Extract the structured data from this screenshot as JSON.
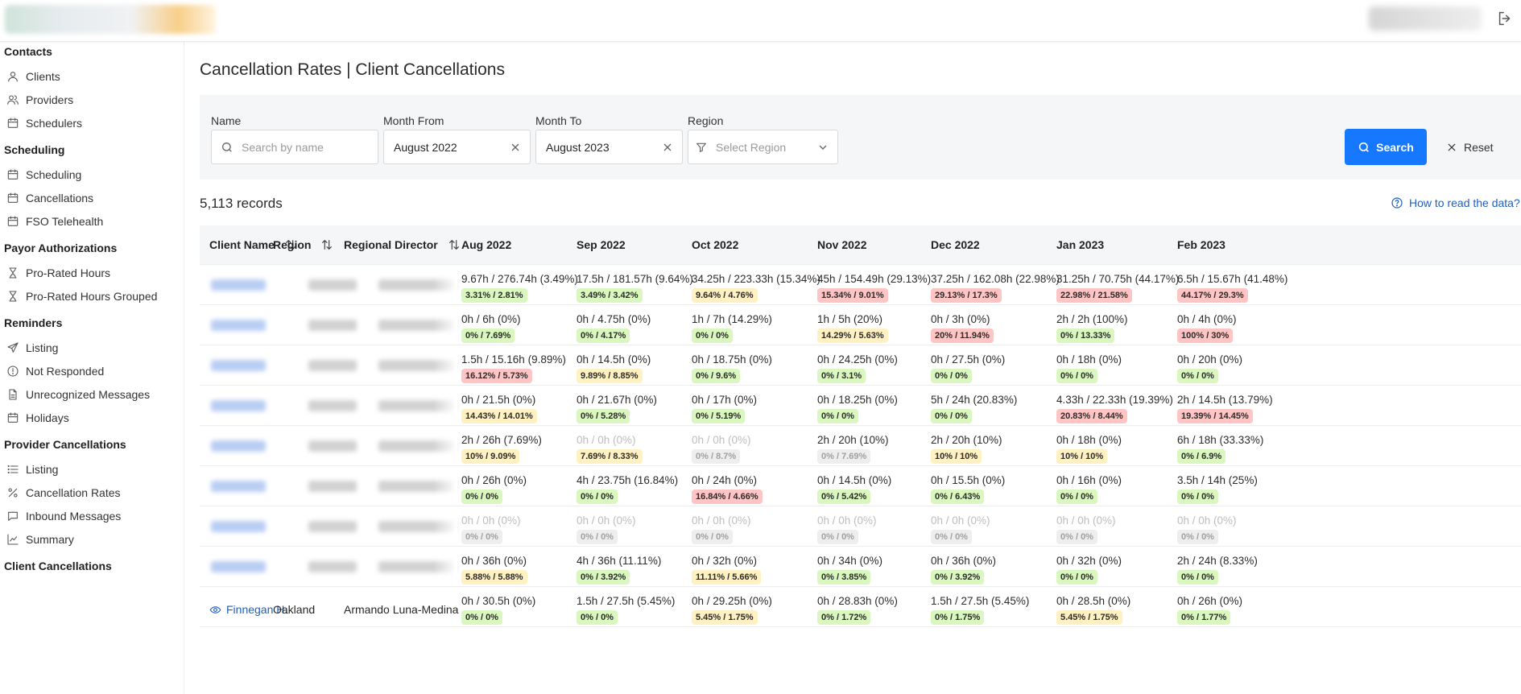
{
  "sidebar": {
    "sections": [
      {
        "title": "Contacts",
        "items": [
          {
            "label": "Clients",
            "icon": "user-icon"
          },
          {
            "label": "Providers",
            "icon": "users-icon"
          },
          {
            "label": "Schedulers",
            "icon": "calendar-icon"
          }
        ]
      },
      {
        "title": "Scheduling",
        "items": [
          {
            "label": "Scheduling",
            "icon": "calendar-icon"
          },
          {
            "label": "Cancellations",
            "icon": "calendar-icon"
          },
          {
            "label": "FSO Telehealth",
            "icon": "calendar-icon"
          }
        ]
      },
      {
        "title": "Payor Authorizations",
        "items": [
          {
            "label": "Pro-Rated Hours",
            "icon": "hourglass-icon"
          },
          {
            "label": "Pro-Rated Hours Grouped",
            "icon": "hourglass-icon"
          }
        ]
      },
      {
        "title": "Reminders",
        "items": [
          {
            "label": "Listing",
            "icon": "send-icon"
          },
          {
            "label": "Not Responded",
            "icon": "alert-circle-icon"
          },
          {
            "label": "Unrecognized Messages",
            "icon": "file-icon"
          },
          {
            "label": "Holidays",
            "icon": "calendar-icon"
          }
        ]
      },
      {
        "title": "Provider Cancellations",
        "items": [
          {
            "label": "Listing",
            "icon": "list-icon"
          },
          {
            "label": "Cancellation Rates",
            "icon": "percent-icon"
          },
          {
            "label": "Inbound Messages",
            "icon": "message-icon"
          },
          {
            "label": "Summary",
            "icon": "line-chart-icon"
          }
        ]
      },
      {
        "title": "Client Cancellations",
        "items": []
      }
    ]
  },
  "page": {
    "title": "Cancellation Rates | Client Cancellations",
    "records": "5,113 records",
    "how_to": "How to read the data?"
  },
  "filters": {
    "name": {
      "label": "Name",
      "placeholder": "Search by name"
    },
    "month_from": {
      "label": "Month From",
      "value": "August 2022"
    },
    "month_to": {
      "label": "Month To",
      "value": "August 2023"
    },
    "region": {
      "label": "Region",
      "placeholder": "Select Region"
    },
    "search_label": "Search",
    "reset_label": "Reset"
  },
  "table": {
    "headers": [
      "Client Name",
      "Region",
      "Regional Director",
      "Aug 2022",
      "Sep 2022",
      "Oct 2022",
      "Nov 2022",
      "Dec 2022",
      "Jan 2023",
      "Feb 2023"
    ],
    "rows": [
      {
        "name": "",
        "region": "",
        "director": "",
        "cells": [
          {
            "v": "9.67h / 276.74h (3.49%)",
            "t": "3.31% / 2.81%",
            "c": "green"
          },
          {
            "v": "17.5h / 181.57h (9.64%)",
            "t": "3.49% / 3.42%",
            "c": "green"
          },
          {
            "v": "34.25h / 223.33h (15.34%)",
            "t": "9.64% / 4.76%",
            "c": "yellow"
          },
          {
            "v": "45h / 154.49h (29.13%)",
            "t": "15.34% / 9.01%",
            "c": "red"
          },
          {
            "v": "37.25h / 162.08h (22.98%)",
            "t": "29.13% / 17.3%",
            "c": "red"
          },
          {
            "v": "31.25h / 70.75h (44.17%)",
            "t": "22.98% / 21.58%",
            "c": "red"
          },
          {
            "v": "6.5h / 15.67h (41.48%)",
            "t": "44.17% / 29.3%",
            "c": "red"
          }
        ]
      },
      {
        "name": "",
        "region": "",
        "director": "",
        "cells": [
          {
            "v": "0h / 6h (0%)",
            "t": "0% / 7.69%",
            "c": "green"
          },
          {
            "v": "0h / 4.75h (0%)",
            "t": "0% / 4.17%",
            "c": "green"
          },
          {
            "v": "1h / 7h (14.29%)",
            "t": "0% / 0%",
            "c": "green"
          },
          {
            "v": "1h / 5h (20%)",
            "t": "14.29% / 5.63%",
            "c": "yellow"
          },
          {
            "v": "0h / 3h (0%)",
            "t": "20% / 11.94%",
            "c": "red"
          },
          {
            "v": "2h / 2h (100%)",
            "t": "0% / 13.33%",
            "c": "green"
          },
          {
            "v": "0h / 4h (0%)",
            "t": "100% / 30%",
            "c": "red"
          }
        ]
      },
      {
        "name": "",
        "region": "",
        "director": "",
        "cells": [
          {
            "v": "1.5h / 15.16h (9.89%)",
            "t": "16.12% / 5.73%",
            "c": "red"
          },
          {
            "v": "0h / 14.5h (0%)",
            "t": "9.89% / 8.85%",
            "c": "yellow"
          },
          {
            "v": "0h / 18.75h (0%)",
            "t": "0% / 9.6%",
            "c": "green"
          },
          {
            "v": "0h / 24.25h (0%)",
            "t": "0% / 3.1%",
            "c": "green"
          },
          {
            "v": "0h / 27.5h (0%)",
            "t": "0% / 0%",
            "c": "green"
          },
          {
            "v": "0h / 18h (0%)",
            "t": "0% / 0%",
            "c": "green"
          },
          {
            "v": "0h / 20h (0%)",
            "t": "0% / 0%",
            "c": "green"
          }
        ]
      },
      {
        "name": "",
        "region": "",
        "director": "",
        "cells": [
          {
            "v": "0h / 21.5h (0%)",
            "t": "14.43% / 14.01%",
            "c": "yellow"
          },
          {
            "v": "0h / 21.67h (0%)",
            "t": "0% / 5.28%",
            "c": "green"
          },
          {
            "v": "0h / 17h (0%)",
            "t": "0% / 5.19%",
            "c": "green"
          },
          {
            "v": "0h / 18.25h (0%)",
            "t": "0% / 0%",
            "c": "green"
          },
          {
            "v": "5h / 24h (20.83%)",
            "t": "0% / 0%",
            "c": "green"
          },
          {
            "v": "4.33h / 22.33h (19.39%)",
            "t": "20.83% / 8.44%",
            "c": "red"
          },
          {
            "v": "2h / 14.5h (13.79%)",
            "t": "19.39% / 14.45%",
            "c": "red"
          }
        ]
      },
      {
        "name": "",
        "region": "",
        "director": "",
        "cells": [
          {
            "v": "2h / 26h (7.69%)",
            "t": "10% / 9.09%",
            "c": "yellow"
          },
          {
            "v": "0h / 0h (0%)",
            "t": "7.69% / 8.33%",
            "c": "yellow",
            "grey": true
          },
          {
            "v": "0h / 0h (0%)",
            "t": "0% / 8.7%",
            "c": "gray",
            "grey": true
          },
          {
            "v": "2h / 20h (10%)",
            "t": "0% / 7.69%",
            "c": "gray"
          },
          {
            "v": "2h / 20h (10%)",
            "t": "10% / 10%",
            "c": "yellow"
          },
          {
            "v": "0h / 18h (0%)",
            "t": "10% / 10%",
            "c": "yellow"
          },
          {
            "v": "6h / 18h (33.33%)",
            "t": "0% / 6.9%",
            "c": "green"
          }
        ]
      },
      {
        "name": "",
        "region": "",
        "director": "",
        "cells": [
          {
            "v": "0h / 26h (0%)",
            "t": "0% / 0%",
            "c": "green"
          },
          {
            "v": "4h / 23.75h (16.84%)",
            "t": "0% / 0%",
            "c": "green"
          },
          {
            "v": "0h / 24h (0%)",
            "t": "16.84% / 4.66%",
            "c": "red"
          },
          {
            "v": "0h / 14.5h (0%)",
            "t": "0% / 5.42%",
            "c": "green"
          },
          {
            "v": "0h / 15.5h (0%)",
            "t": "0% / 6.43%",
            "c": "green"
          },
          {
            "v": "0h / 16h (0%)",
            "t": "0% / 0%",
            "c": "green"
          },
          {
            "v": "3.5h / 14h (25%)",
            "t": "0% / 0%",
            "c": "green"
          }
        ]
      },
      {
        "name": "",
        "region": "",
        "director": "",
        "cells": [
          {
            "v": "0h / 0h (0%)",
            "t": "0% / 0%",
            "c": "gray",
            "grey": true
          },
          {
            "v": "0h / 0h (0%)",
            "t": "0% / 0%",
            "c": "gray",
            "grey": true
          },
          {
            "v": "0h / 0h (0%)",
            "t": "0% / 0%",
            "c": "gray",
            "grey": true
          },
          {
            "v": "0h / 0h (0%)",
            "t": "0% / 0%",
            "c": "gray",
            "grey": true
          },
          {
            "v": "0h / 0h (0%)",
            "t": "0% / 0%",
            "c": "gray",
            "grey": true
          },
          {
            "v": "0h / 0h (0%)",
            "t": "0% / 0%",
            "c": "gray",
            "grey": true
          },
          {
            "v": "0h / 0h (0%)",
            "t": "0% / 0%",
            "c": "gray",
            "grey": true
          }
        ]
      },
      {
        "name": "",
        "region": "",
        "director": "",
        "cells": [
          {
            "v": "0h / 36h (0%)",
            "t": "5.88% / 5.88%",
            "c": "yellow"
          },
          {
            "v": "4h / 36h (11.11%)",
            "t": "0% / 3.92%",
            "c": "green"
          },
          {
            "v": "0h / 32h (0%)",
            "t": "11.11% / 5.66%",
            "c": "yellow"
          },
          {
            "v": "0h / 34h (0%)",
            "t": "0% / 3.85%",
            "c": "green"
          },
          {
            "v": "0h / 36h (0%)",
            "t": "0% / 3.92%",
            "c": "green"
          },
          {
            "v": "0h / 32h (0%)",
            "t": "0% / 0%",
            "c": "green"
          },
          {
            "v": "2h / 24h (8.33%)",
            "t": "0% / 0%",
            "c": "green"
          }
        ]
      },
      {
        "name": "Finnegan H.",
        "region": "Oakland",
        "director": "Armando Luna-Medina",
        "cells": [
          {
            "v": "0h / 30.5h (0%)",
            "t": "0% / 0%",
            "c": "green"
          },
          {
            "v": "1.5h / 27.5h (5.45%)",
            "t": "0% / 0%",
            "c": "green"
          },
          {
            "v": "0h / 29.25h (0%)",
            "t": "5.45% / 1.75%",
            "c": "yellow"
          },
          {
            "v": "0h / 28.83h (0%)",
            "t": "0% / 1.72%",
            "c": "green"
          },
          {
            "v": "1.5h / 27.5h (5.45%)",
            "t": "0% / 1.75%",
            "c": "green"
          },
          {
            "v": "0h / 28.5h (0%)",
            "t": "5.45% / 1.75%",
            "c": "yellow"
          },
          {
            "v": "0h / 26h (0%)",
            "t": "0% / 1.77%",
            "c": "green"
          }
        ]
      }
    ]
  }
}
